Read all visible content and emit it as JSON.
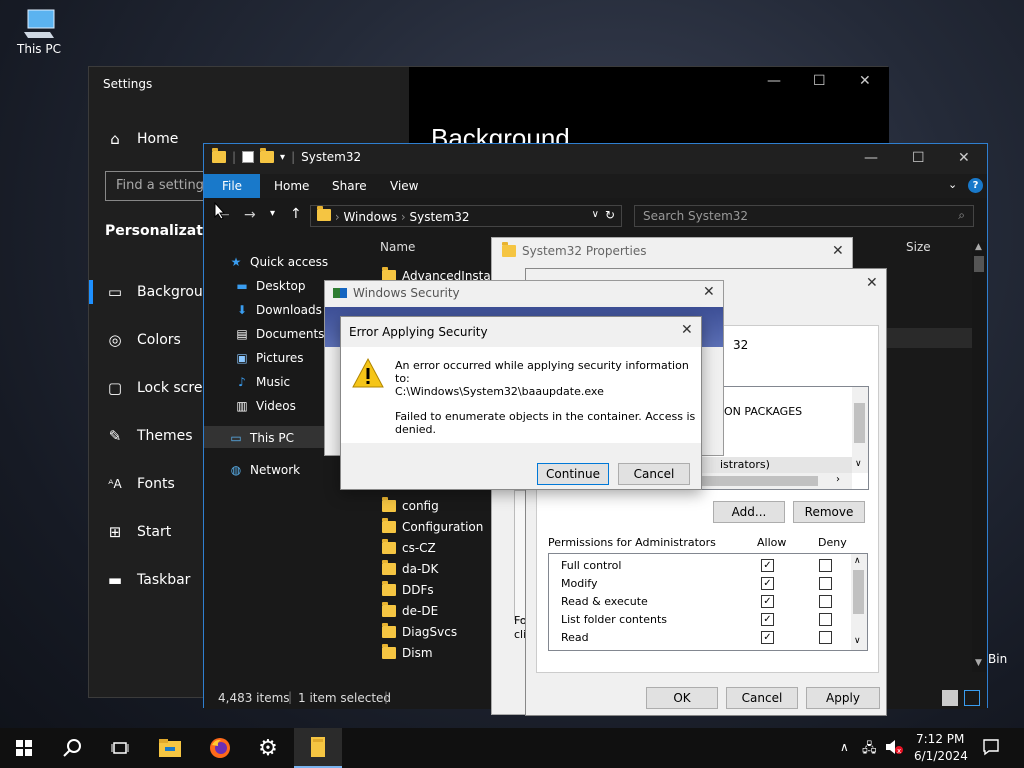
{
  "desktop": {
    "this_pc_label": "This PC",
    "recycle_bin_label": "Bin"
  },
  "settings": {
    "title": "Settings",
    "controls": {
      "minimize": "—",
      "maximize": "☐",
      "close": "✕"
    },
    "home_label": "Home",
    "search_placeholder": "Find a setting",
    "section_label": "Personalization",
    "nav_items": [
      {
        "label": "Background",
        "icon": "image-icon",
        "selected": true
      },
      {
        "label": "Colors",
        "icon": "palette-icon"
      },
      {
        "label": "Lock screen",
        "icon": "lock-screen-icon"
      },
      {
        "label": "Themes",
        "icon": "brush-icon"
      },
      {
        "label": "Fonts",
        "icon": "font-icon"
      },
      {
        "label": "Start",
        "icon": "start-icon"
      },
      {
        "label": "Taskbar",
        "icon": "taskbar-icon"
      }
    ],
    "page_title": "Background",
    "accent_color": "#1e90ff"
  },
  "explorer": {
    "title": "System32",
    "ribbon_tabs": [
      "File",
      "Home",
      "Share",
      "View"
    ],
    "address": {
      "part1": "Windows",
      "part2": "System32"
    },
    "search_placeholder": "Search System32",
    "column_name": "Name",
    "column_size": "Size",
    "nav_items": [
      {
        "label": "Quick access",
        "icon": "star-icon"
      },
      {
        "label": "Desktop",
        "icon": "desktop-folder-icon"
      },
      {
        "label": "Downloads",
        "icon": "download-icon"
      },
      {
        "label": "Documents",
        "icon": "documents-icon"
      },
      {
        "label": "Pictures",
        "icon": "pictures-icon"
      },
      {
        "label": "Music",
        "icon": "music-icon"
      },
      {
        "label": "Videos",
        "icon": "videos-icon"
      },
      {
        "label": "This PC",
        "icon": "computer-icon"
      },
      {
        "label": "Network",
        "icon": "network-icon"
      }
    ],
    "files": [
      "AdvancedInstaller",
      "config",
      "Configuration",
      "cs-CZ",
      "da-DK",
      "DDFs",
      "de-DE",
      "DiagSvcs",
      "Dism"
    ],
    "status_items": "4,483 items",
    "status_selected": "1 item selected",
    "accent_color": "#1979ca"
  },
  "properties": {
    "title": "System32 Properties",
    "visible_fragment": "32"
  },
  "permissions": {
    "list_text": "ON PACKAGES",
    "list_selected": "istrators)",
    "add_button": "Add...",
    "remove_button": "Remove",
    "perm_header": "Permissions for Administrators",
    "allow_header": "Allow",
    "deny_header": "Deny",
    "rows": [
      {
        "label": "Full control",
        "allow": true,
        "deny": false
      },
      {
        "label": "Modify",
        "allow": true,
        "deny": false
      },
      {
        "label": "Read & execute",
        "allow": true,
        "deny": false
      },
      {
        "label": "List folder contents",
        "allow": true,
        "deny": false
      },
      {
        "label": "Read",
        "allow": true,
        "deny": false
      }
    ],
    "left_fragment_1": "Fo",
    "left_fragment_2": "clic",
    "ok_button": "OK",
    "cancel_button": "Cancel",
    "apply_button": "Apply"
  },
  "windows_security": {
    "title": "Windows Security"
  },
  "error_dialog": {
    "title": "Error Applying Security",
    "line1": "An error occurred while applying security information to:",
    "line2": "C:\\Windows\\System32\\baaupdate.exe",
    "line3": "Failed to enumerate objects in the container. Access is denied.",
    "continue_button": "Continue",
    "cancel_button": "Cancel"
  },
  "taskbar": {
    "time": "7:12 PM",
    "date": "6/1/2024"
  }
}
